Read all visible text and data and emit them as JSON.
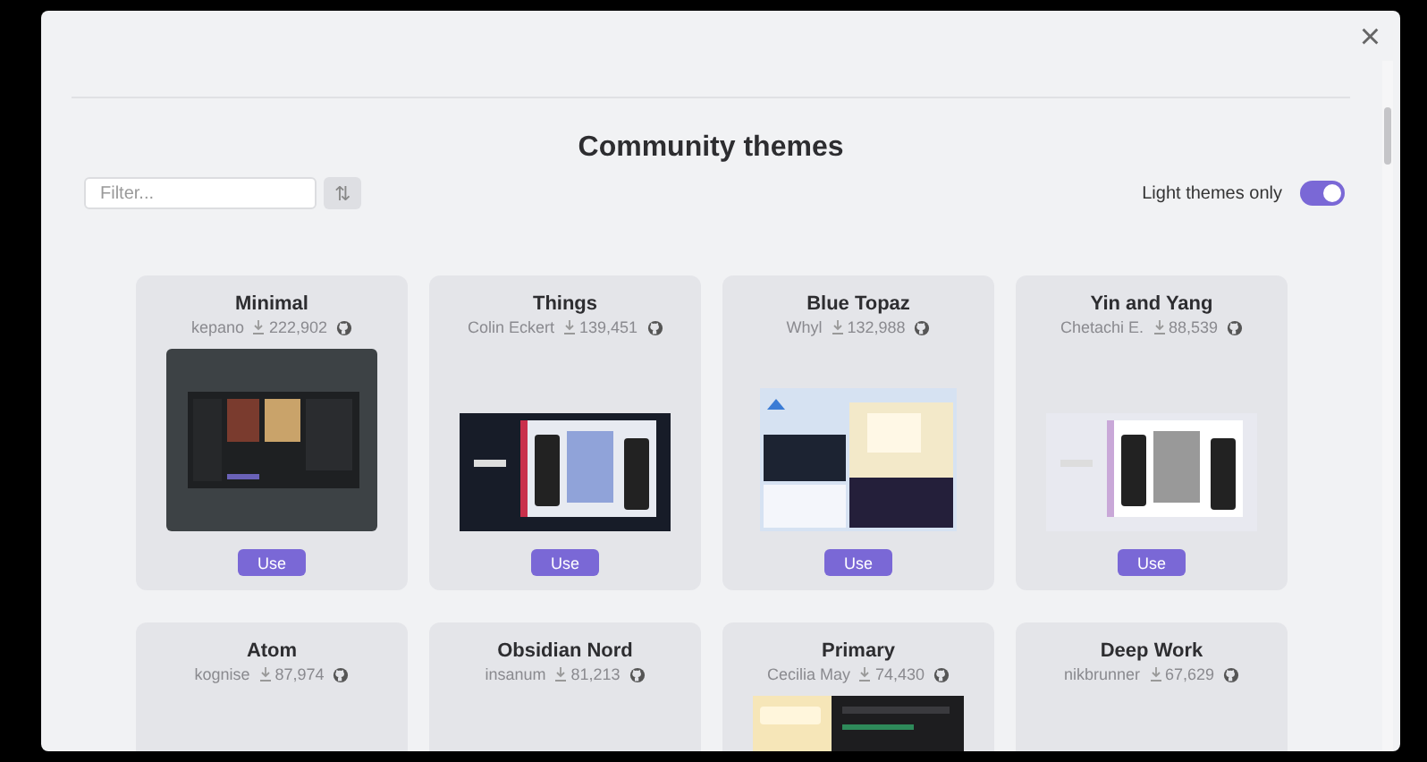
{
  "modal": {
    "close": "×",
    "title": "Community themes",
    "filter": {
      "placeholder": "Filter..."
    },
    "sort": "⇅",
    "light_only": {
      "label": "Light themes only",
      "on": true
    }
  },
  "themes": [
    {
      "name": "Minimal",
      "author": "kepano",
      "downloads": "222,902",
      "preview": {
        "kind": "framed"
      },
      "button": "Use"
    },
    {
      "name": "Things",
      "author": "Colin Eckert",
      "downloads": "139,451",
      "preview": {
        "kind": "wide"
      },
      "button": "Use"
    },
    {
      "name": "Blue Topaz",
      "author": "Whyl",
      "downloads": "132,988",
      "preview": {
        "kind": "tall"
      },
      "button": "Use"
    },
    {
      "name": "Yin and Yang",
      "author": "Chetachi E.",
      "downloads": "88,539",
      "preview": {
        "kind": "wide"
      },
      "button": "Use"
    },
    {
      "name": "Atom",
      "author": "kognise",
      "downloads": "87,974"
    },
    {
      "name": "Obsidian Nord",
      "author": "insanum",
      "downloads": "81,213"
    },
    {
      "name": "Primary",
      "author": "Cecilia May",
      "downloads": "74,430",
      "preview": {
        "kind": "banner"
      }
    },
    {
      "name": "Deep Work",
      "author": "nikbrunner",
      "downloads": "67,629"
    }
  ]
}
